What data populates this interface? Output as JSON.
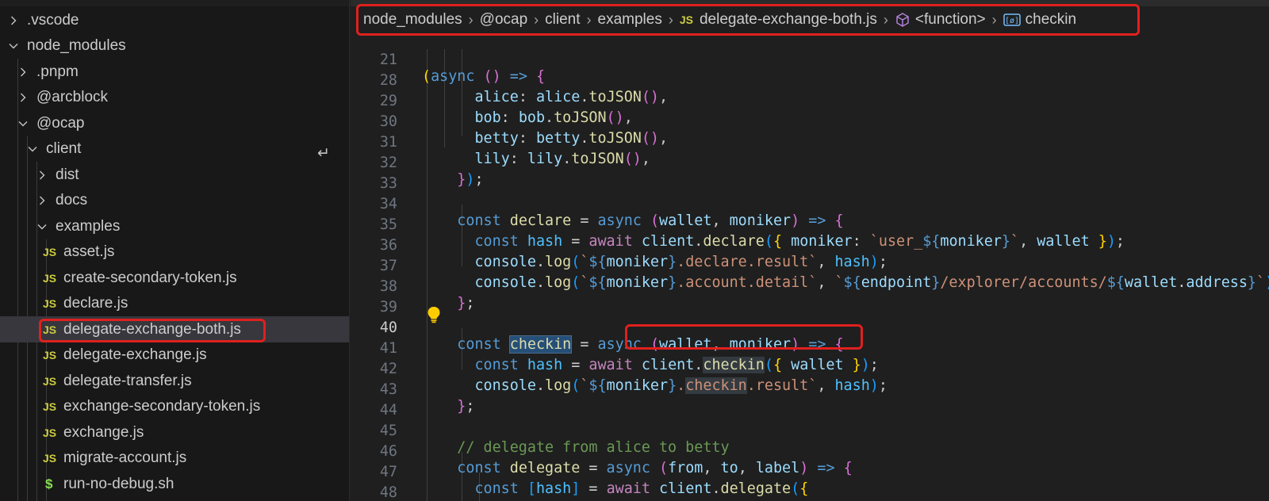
{
  "explorer": {
    "items": [
      {
        "label": ".vscode",
        "kind": "folder",
        "expanded": false
      },
      {
        "label": "node_modules",
        "kind": "folder",
        "expanded": true
      },
      {
        "label": ".pnpm",
        "kind": "folder",
        "expanded": false
      },
      {
        "label": "@arcblock",
        "kind": "folder",
        "expanded": false
      },
      {
        "label": "@ocap",
        "kind": "folder",
        "expanded": true
      },
      {
        "label": "client",
        "kind": "folder",
        "expanded": true
      },
      {
        "label": "dist",
        "kind": "folder",
        "expanded": false
      },
      {
        "label": "docs",
        "kind": "folder",
        "expanded": false
      },
      {
        "label": "examples",
        "kind": "folder",
        "expanded": true
      },
      {
        "label": "asset.js",
        "kind": "js"
      },
      {
        "label": "create-secondary-token.js",
        "kind": "js"
      },
      {
        "label": "declare.js",
        "kind": "js"
      },
      {
        "label": "delegate-exchange-both.js",
        "kind": "js",
        "selected": true
      },
      {
        "label": "delegate-exchange.js",
        "kind": "js"
      },
      {
        "label": "delegate-transfer.js",
        "kind": "js"
      },
      {
        "label": "exchange-secondary-token.js",
        "kind": "js"
      },
      {
        "label": "exchange.js",
        "kind": "js"
      },
      {
        "label": "migrate-account.js",
        "kind": "js"
      },
      {
        "label": "run-no-debug.sh",
        "kind": "sh"
      }
    ],
    "js_badge": "JS",
    "sh_badge": "$"
  },
  "breadcrumb": {
    "items": [
      "node_modules",
      "@ocap",
      "client",
      "examples",
      "delegate-exchange-both.js",
      "<function>",
      "checkin"
    ],
    "file_badge": "JS"
  },
  "editor": {
    "line_numbers": [
      "21",
      "28",
      "29",
      "30",
      "31",
      "32",
      "33",
      "34",
      "35",
      "36",
      "37",
      "38",
      "39",
      "40",
      "41",
      "42",
      "43",
      "44",
      "45",
      "46",
      "47",
      "48"
    ],
    "active_line": "40"
  },
  "colors": {
    "annotation_red": "#e0201e",
    "selection_bg": "#37373d",
    "js_yellow": "#cbcb41"
  }
}
